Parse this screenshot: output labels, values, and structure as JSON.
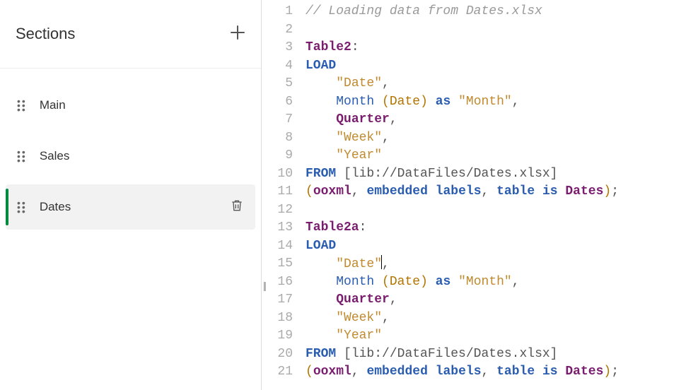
{
  "sidebar": {
    "title": "Sections",
    "items": [
      {
        "label": "Main",
        "active": false
      },
      {
        "label": "Sales",
        "active": false
      },
      {
        "label": "Dates",
        "active": true
      }
    ]
  },
  "editor": {
    "line_count": 21,
    "cursor": {
      "line": 15,
      "after_token": 1
    },
    "lines": [
      {
        "n": 1,
        "tokens": [
          {
            "t": "// Loading data from Dates.xlsx",
            "c": "comment"
          }
        ]
      },
      {
        "n": 2,
        "tokens": []
      },
      {
        "n": 3,
        "tokens": [
          {
            "t": "Table2",
            "c": "ident"
          },
          {
            "t": ":",
            "c": "punct"
          }
        ]
      },
      {
        "n": 4,
        "tokens": [
          {
            "t": "LOAD",
            "c": "keyword"
          }
        ]
      },
      {
        "n": 5,
        "tokens": [
          {
            "t": "    ",
            "c": "plain"
          },
          {
            "t": "\"Date\"",
            "c": "string"
          },
          {
            "t": ",",
            "c": "punct"
          }
        ]
      },
      {
        "n": 6,
        "tokens": [
          {
            "t": "    ",
            "c": "plain"
          },
          {
            "t": "Month",
            "c": "func"
          },
          {
            "t": " ",
            "c": "plain"
          },
          {
            "t": "(",
            "c": "paren"
          },
          {
            "t": "Date",
            "c": "paren"
          },
          {
            "t": ")",
            "c": "paren"
          },
          {
            "t": " ",
            "c": "plain"
          },
          {
            "t": "as",
            "c": "keyword"
          },
          {
            "t": " ",
            "c": "plain"
          },
          {
            "t": "\"Month\"",
            "c": "string"
          },
          {
            "t": ",",
            "c": "punct"
          }
        ]
      },
      {
        "n": 7,
        "tokens": [
          {
            "t": "    ",
            "c": "plain"
          },
          {
            "t": "Quarter",
            "c": "ident"
          },
          {
            "t": ",",
            "c": "punct"
          }
        ]
      },
      {
        "n": 8,
        "tokens": [
          {
            "t": "    ",
            "c": "plain"
          },
          {
            "t": "\"Week\"",
            "c": "string"
          },
          {
            "t": ",",
            "c": "punct"
          }
        ]
      },
      {
        "n": 9,
        "tokens": [
          {
            "t": "    ",
            "c": "plain"
          },
          {
            "t": "\"Year\"",
            "c": "string"
          }
        ]
      },
      {
        "n": 10,
        "tokens": [
          {
            "t": "FROM",
            "c": "keyword"
          },
          {
            "t": " ",
            "c": "plain"
          },
          {
            "t": "[lib://DataFiles/Dates.xlsx]",
            "c": "path"
          }
        ]
      },
      {
        "n": 11,
        "tokens": [
          {
            "t": "(",
            "c": "paren"
          },
          {
            "t": "ooxml",
            "c": "ident"
          },
          {
            "t": ",",
            "c": "punct"
          },
          {
            "t": " ",
            "c": "plain"
          },
          {
            "t": "embedded",
            "c": "keyword"
          },
          {
            "t": " ",
            "c": "plain"
          },
          {
            "t": "labels",
            "c": "keyword"
          },
          {
            "t": ",",
            "c": "punct"
          },
          {
            "t": " ",
            "c": "plain"
          },
          {
            "t": "table",
            "c": "keyword"
          },
          {
            "t": " ",
            "c": "plain"
          },
          {
            "t": "is",
            "c": "keyword"
          },
          {
            "t": " ",
            "c": "plain"
          },
          {
            "t": "Dates",
            "c": "ident"
          },
          {
            "t": ")",
            "c": "paren"
          },
          {
            "t": ";",
            "c": "punct"
          }
        ]
      },
      {
        "n": 12,
        "tokens": []
      },
      {
        "n": 13,
        "tokens": [
          {
            "t": "Table2a",
            "c": "ident"
          },
          {
            "t": ":",
            "c": "punct"
          }
        ]
      },
      {
        "n": 14,
        "tokens": [
          {
            "t": "LOAD",
            "c": "keyword"
          }
        ]
      },
      {
        "n": 15,
        "tokens": [
          {
            "t": "    ",
            "c": "plain"
          },
          {
            "t": "\"Date\"",
            "c": "string"
          },
          {
            "t": ",",
            "c": "punct"
          }
        ]
      },
      {
        "n": 16,
        "tokens": [
          {
            "t": "    ",
            "c": "plain"
          },
          {
            "t": "Month",
            "c": "func"
          },
          {
            "t": " ",
            "c": "plain"
          },
          {
            "t": "(",
            "c": "paren"
          },
          {
            "t": "Date",
            "c": "paren"
          },
          {
            "t": ")",
            "c": "paren"
          },
          {
            "t": " ",
            "c": "plain"
          },
          {
            "t": "as",
            "c": "keyword"
          },
          {
            "t": " ",
            "c": "plain"
          },
          {
            "t": "\"Month\"",
            "c": "string"
          },
          {
            "t": ",",
            "c": "punct"
          }
        ]
      },
      {
        "n": 17,
        "tokens": [
          {
            "t": "    ",
            "c": "plain"
          },
          {
            "t": "Quarter",
            "c": "ident"
          },
          {
            "t": ",",
            "c": "punct"
          }
        ]
      },
      {
        "n": 18,
        "tokens": [
          {
            "t": "    ",
            "c": "plain"
          },
          {
            "t": "\"Week\"",
            "c": "string"
          },
          {
            "t": ",",
            "c": "punct"
          }
        ]
      },
      {
        "n": 19,
        "tokens": [
          {
            "t": "    ",
            "c": "plain"
          },
          {
            "t": "\"Year\"",
            "c": "string"
          }
        ]
      },
      {
        "n": 20,
        "tokens": [
          {
            "t": "FROM",
            "c": "keyword"
          },
          {
            "t": " ",
            "c": "plain"
          },
          {
            "t": "[lib://DataFiles/Dates.xlsx]",
            "c": "path"
          }
        ]
      },
      {
        "n": 21,
        "tokens": [
          {
            "t": "(",
            "c": "paren"
          },
          {
            "t": "ooxml",
            "c": "ident"
          },
          {
            "t": ",",
            "c": "punct"
          },
          {
            "t": " ",
            "c": "plain"
          },
          {
            "t": "embedded",
            "c": "keyword"
          },
          {
            "t": " ",
            "c": "plain"
          },
          {
            "t": "labels",
            "c": "keyword"
          },
          {
            "t": ",",
            "c": "punct"
          },
          {
            "t": " ",
            "c": "plain"
          },
          {
            "t": "table",
            "c": "keyword"
          },
          {
            "t": " ",
            "c": "plain"
          },
          {
            "t": "is",
            "c": "keyword"
          },
          {
            "t": " ",
            "c": "plain"
          },
          {
            "t": "Dates",
            "c": "ident"
          },
          {
            "t": ")",
            "c": "paren"
          },
          {
            "t": ";",
            "c": "punct"
          }
        ]
      }
    ]
  }
}
